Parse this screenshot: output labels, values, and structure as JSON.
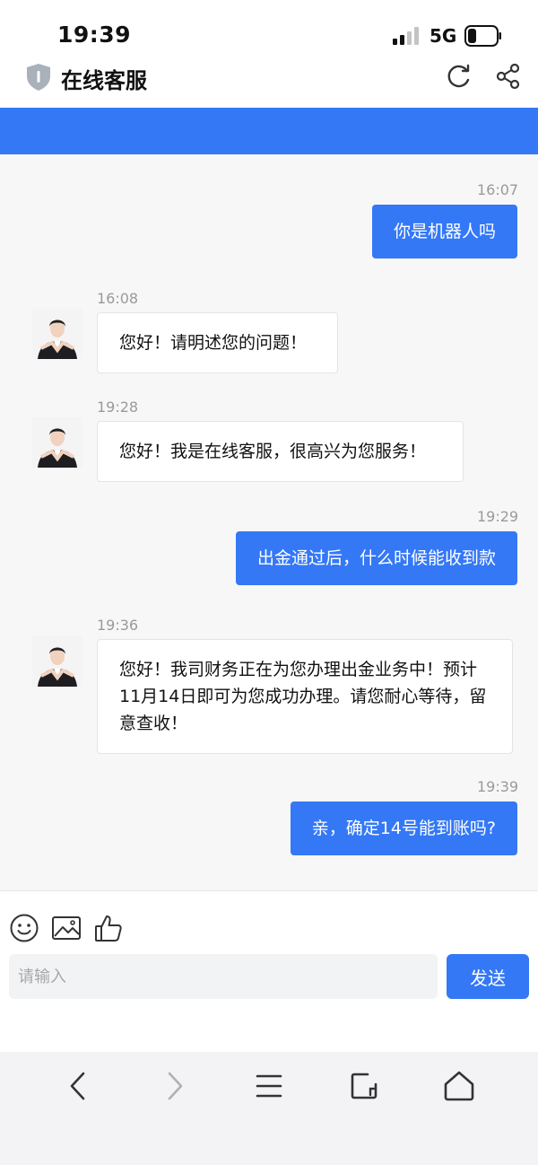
{
  "status_bar": {
    "time": "19:39",
    "network": "5G"
  },
  "title_bar": {
    "title": "在线客服"
  },
  "messages": [
    {
      "side": "right",
      "time": "16:07",
      "text": "你是机器人吗"
    },
    {
      "side": "left",
      "time": "16:08",
      "text": "您好！请明述您的问题！"
    },
    {
      "side": "left",
      "time": "19:28",
      "text": "您好！我是在线客服，很高兴为您服务！"
    },
    {
      "side": "right",
      "time": "19:29",
      "text": "出金通过后，什么时候能收到款"
    },
    {
      "side": "left",
      "time": "19:36",
      "text": "您好！我司财务正在为您办理出金业务中！预计11月14日即可为您成功办理。请您耐心等待，留意查收！"
    },
    {
      "side": "right",
      "time": "19:39",
      "text": "亲，确定14号能到账吗?"
    }
  ],
  "input": {
    "placeholder": "请输入",
    "value": "",
    "send_label": "发送"
  },
  "colors": {
    "accent": "#3478f6",
    "background": "#f7f7f7"
  },
  "icons": {
    "toolbar": [
      "smiley-icon",
      "image-icon",
      "thumbs-up-icon"
    ],
    "nav": [
      "back-icon",
      "forward-icon",
      "menu-icon",
      "tabs-icon",
      "home-icon"
    ]
  }
}
